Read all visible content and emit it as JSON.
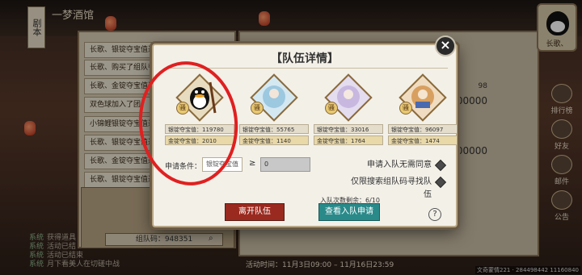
{
  "scene": {
    "back_label": "剧本",
    "title": "一梦酒馆"
  },
  "team_list": [
    "长歌、银锭夺宝值达",
    "长歌、购买了组队夺",
    "长歌、金锭夺宝值达",
    "双色球加入了团",
    "小锦鲤银锭夺宝值达",
    "长歌、银锭夺宝值达",
    "长歌、金锭夺宝值达",
    "长歌、银锭夺宝值达"
  ],
  "team_code": "组队码：948351",
  "right_side_buttons": [
    "排行榜",
    "好友",
    "邮件",
    "公告"
  ],
  "top_avatar_label": "长歌、",
  "right_values": [
    "98",
    "00000",
    "00000"
  ],
  "system_log": [
    {
      "tag": "系统",
      "text": "获得道具"
    },
    {
      "tag": "系统",
      "text": "活动已结"
    },
    {
      "tag": "系统",
      "text": "活动已结束"
    },
    {
      "tag": "系统",
      "text": "月下看美人在切磋中战"
    }
  ],
  "activity_time": "活动时间：11月3日09:00 – 11月16日23:59",
  "corner_info": "文奇蒙情221 · 284498442 11160840",
  "modal": {
    "title": "【队伍详情】",
    "close_icon": "×",
    "members": [
      {
        "badge": "骚",
        "silver": "银锭夺宝值：119780",
        "gold": "金锭夺宝值：2010",
        "color": "#1a1a1a"
      },
      {
        "badge": "骚",
        "silver": "银锭夺宝值：55765",
        "gold": "金锭夺宝值：1140",
        "color": "#6fb4d8"
      },
      {
        "badge": "骚",
        "silver": "银锭夺宝值：33016",
        "gold": "金锭夺宝值：1764",
        "color": "#b8a8d0"
      },
      {
        "badge": "骚",
        "silver": "银锭夺宝值：96097",
        "gold": "金锭夺宝值：1474",
        "color": "#d89848"
      }
    ],
    "apply_label": "申请条件：",
    "apply_select": "银锭夺宝值",
    "geq": "≥",
    "apply_value": "0",
    "option_no_approval": "申请入队无需同意",
    "option_code_only": "仅限搜索组队码寻找队伍",
    "leave_button": "离开队伍",
    "remaining": "入队次数剩余：6/10",
    "view_button": "查看入队申请",
    "help": "?"
  },
  "colors": {
    "annotation": "#e02020",
    "leave": "#9a2a20",
    "view": "#2a8a8a"
  }
}
